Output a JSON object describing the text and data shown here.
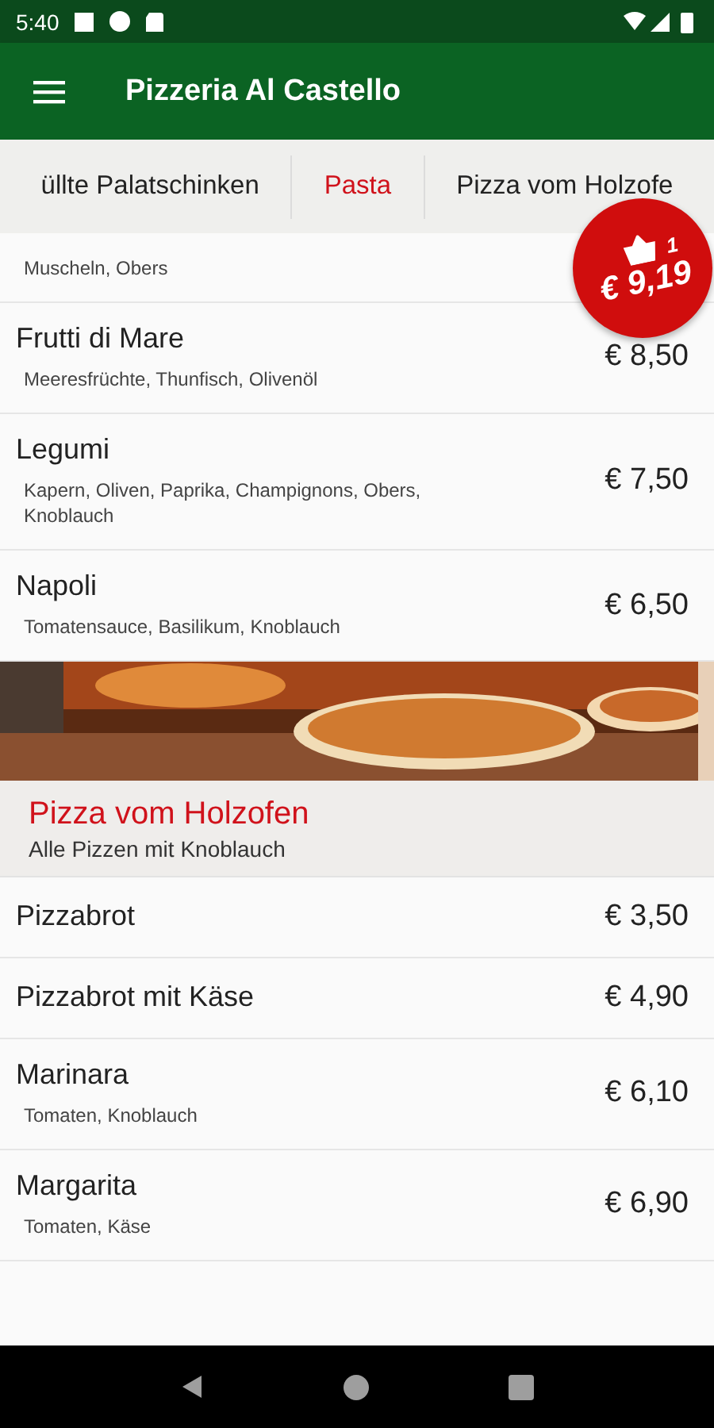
{
  "status_bar": {
    "time": "5:40"
  },
  "app_bar": {
    "title": "Pizzeria Al Castello"
  },
  "tabs": [
    {
      "label": "üllte Palatschinken",
      "selected": false
    },
    {
      "label": "Pasta",
      "selected": true
    },
    {
      "label": "Pizza vom Holzofe",
      "selected": false
    }
  ],
  "cart": {
    "count": "1",
    "total": "€ 9,19"
  },
  "sections": [
    {
      "items": [
        {
          "description": "Muscheln, Obers"
        },
        {
          "name": "Frutti di Mare",
          "description": "Meeresfrüchte, Thunfisch, Olivenöl",
          "price": "€ 8,50"
        },
        {
          "name": "Legumi",
          "description": "Kapern, Oliven, Paprika, Champignons, Obers, Knoblauch",
          "price": "€ 7,50"
        },
        {
          "name": "Napoli",
          "description": "Tomatensauce, Basilikum, Knoblauch",
          "price": "€ 6,50"
        }
      ]
    },
    {
      "title": "Pizza vom Holzofen",
      "subtitle": "Alle Pizzen mit Knoblauch",
      "items": [
        {
          "name": "Pizzabrot",
          "price": "€ 3,50"
        },
        {
          "name": "Pizzabrot mit Käse",
          "price": "€ 4,90"
        },
        {
          "name": "Marinara",
          "description": "Tomaten, Knoblauch",
          "price": "€ 6,10"
        },
        {
          "name": "Margarita",
          "description": "Tomaten, Käse",
          "price": "€ 6,90"
        }
      ]
    }
  ]
}
